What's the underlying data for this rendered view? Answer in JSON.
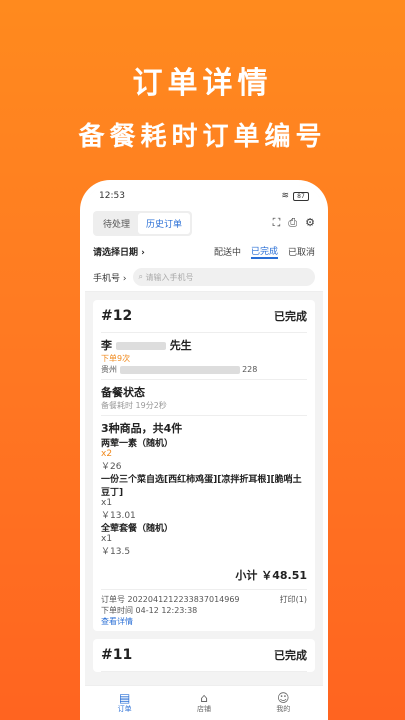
{
  "promo": {
    "title": "订单详情",
    "subtitle": "备餐耗时订单编号"
  },
  "status_bar": {
    "time": "12:53",
    "battery": "87"
  },
  "tabs": [
    "待处理",
    "历史订单"
  ],
  "toolbar_icons": [
    "scan-icon",
    "printer-icon",
    "settings-icon"
  ],
  "filter": {
    "date_label": "请选择日期",
    "statuses": [
      "配送中",
      "已完成",
      "已取消"
    ]
  },
  "search": {
    "phone_select": "手机号",
    "placeholder": "请输入手机号"
  },
  "order": {
    "number": "#12",
    "state": "已完成",
    "customer_prefix": "李",
    "customer_suffix": "先生",
    "order_count": "下单9次",
    "address_prefix": "贵州",
    "address_suffix": "228",
    "prep_title": "备餐状态",
    "prep_time": "备餐耗时 19分2秒",
    "items_summary": "3种商品，共4件",
    "items": [
      {
        "name": "两荤一素（随机）",
        "qty": "x2",
        "price": "￥26"
      },
      {
        "name": "一份三个菜自选[西红柿鸡蛋][凉拌折耳根][脆哨土豆丁]",
        "qty": "x1",
        "price": "￥13.01"
      },
      {
        "name": "全荤套餐（随机）",
        "qty": "x1",
        "price": "￥13.5"
      }
    ],
    "subtotal": "小计 ￥48.51",
    "order_no_label": "订单号 2022041212233837014969",
    "print_label": "打印(1)",
    "order_time": "下单时间 04-12 12:23:38",
    "detail_link": "查看详情"
  },
  "next_order": {
    "number": "#11",
    "state": "已完成"
  },
  "bottom_nav": [
    "订单",
    "店铺",
    "我的"
  ]
}
